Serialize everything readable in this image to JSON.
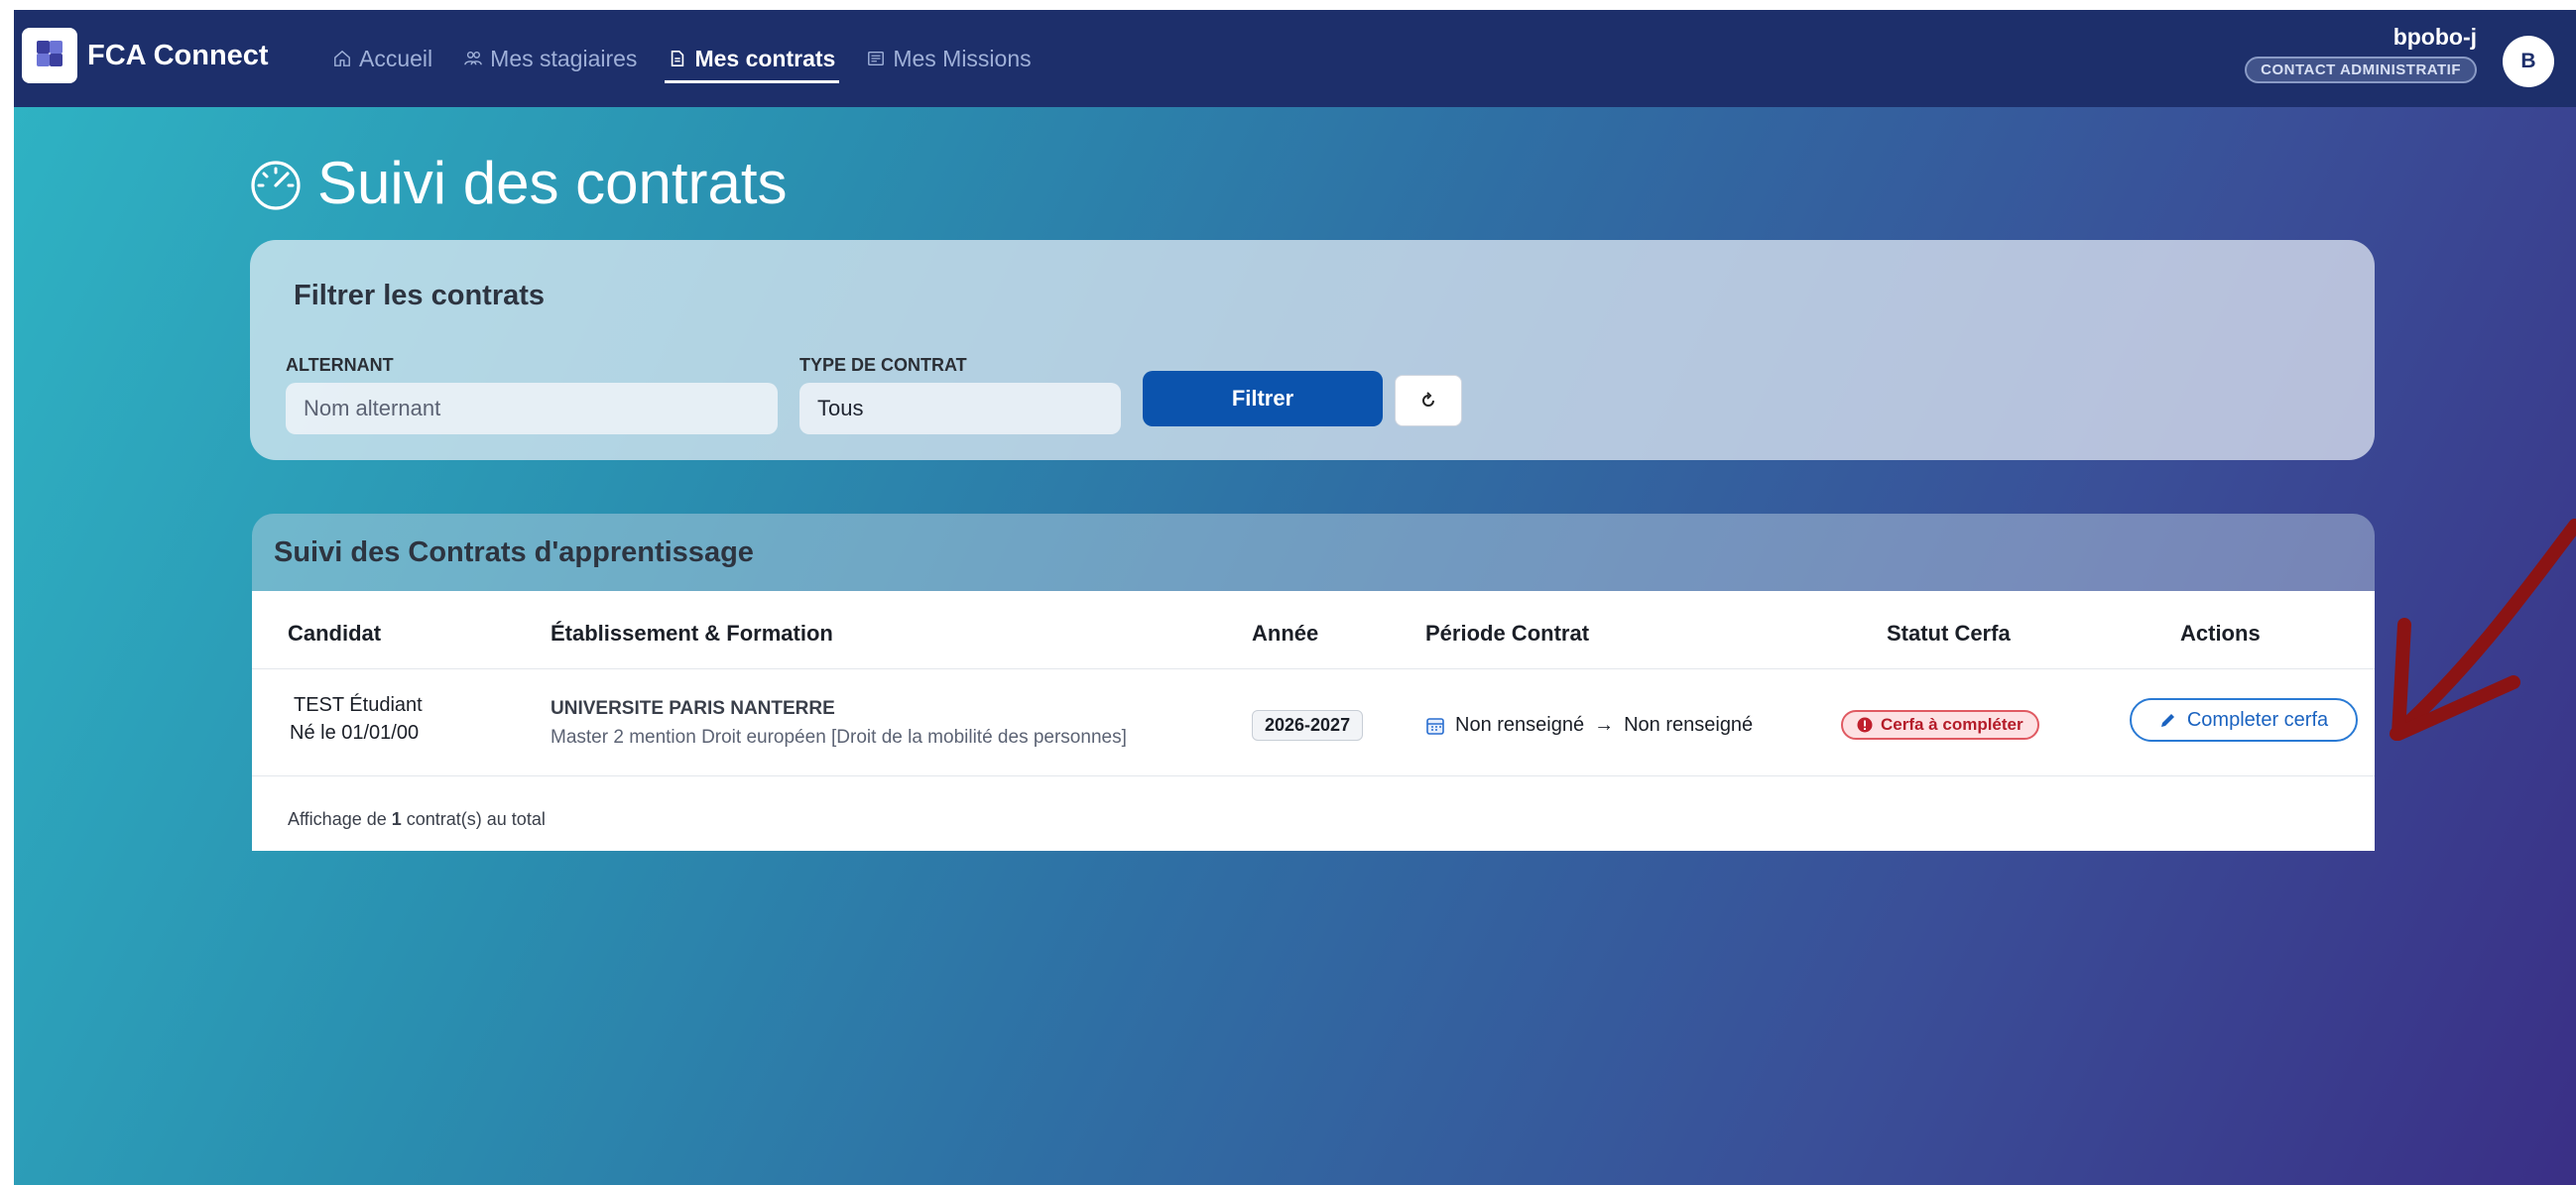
{
  "app": {
    "name": "FCA Connect"
  },
  "nav": {
    "items": [
      {
        "label": "Accueil",
        "icon": "home-icon",
        "active": false
      },
      {
        "label": "Mes stagiaires",
        "icon": "users-icon",
        "active": false
      },
      {
        "label": "Mes contrats",
        "icon": "document-icon",
        "active": true
      },
      {
        "label": "Mes Missions",
        "icon": "list-icon",
        "active": false
      }
    ]
  },
  "user": {
    "name": "bpobo-j",
    "role": "CONTACT ADMINISTRATIF",
    "initial": "B"
  },
  "page": {
    "title": "Suivi des contrats",
    "icon": "speedometer-icon"
  },
  "filter": {
    "title": "Filtrer les contrats",
    "alternant_label": "ALTERNANT",
    "alternant_placeholder": "Nom alternant",
    "type_label": "TYPE DE CONTRAT",
    "type_value": "Tous",
    "filter_button": "Filtrer",
    "reset_icon": "refresh-icon"
  },
  "table": {
    "title": "Suivi des Contrats d'apprentissage",
    "columns": [
      "Candidat",
      "Établissement & Formation",
      "Année",
      "Période Contrat",
      "Statut Cerfa",
      "Actions"
    ],
    "rows": [
      {
        "candidate_name": "TEST Étudiant",
        "candidate_birth": "Né le 01/01/00",
        "institution": "UNIVERSITE PARIS NANTERRE",
        "formation": "Master 2 mention Droit européen [Droit de la mobilité des personnes]",
        "year": "2026-2027",
        "period_start": "Non renseigné",
        "period_end": "Non renseigné",
        "status": "Cerfa à compléter",
        "action": "Completer cerfa"
      }
    ],
    "footer_prefix": "Affichage de ",
    "footer_count": "1",
    "footer_suffix": " contrat(s) au total"
  },
  "colors": {
    "topbar": "#1d2f6b",
    "primary_button": "#0b53ad",
    "status_red": "#b41c29",
    "action_blue": "#2a7ad4",
    "arrow": "#8b1313"
  }
}
